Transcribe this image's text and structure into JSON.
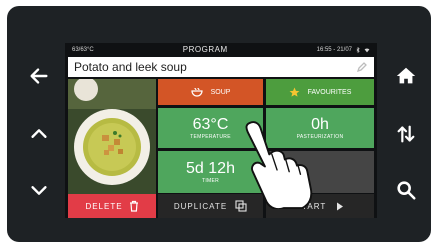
{
  "status": {
    "left": "63/63°C",
    "title": "PROGRAM",
    "right": "16:55 - 21/07"
  },
  "program": {
    "name": "Potato and leek soup"
  },
  "categories": {
    "soup": "SOUP",
    "favourites": "FAVOURITES"
  },
  "params": {
    "temperature_value": "63°C",
    "temperature_label": "TEMPERATURE",
    "duration_value": "0h",
    "duration_label": "PASTEURIZATION",
    "timer_value": "5d 12h",
    "timer_label": "TIMER"
  },
  "actions": {
    "delete": "DELETE",
    "duplicate": "DUPLICATE",
    "start": "START"
  },
  "icons": {
    "back": "arrow-left-icon",
    "up": "chevron-up-icon",
    "down": "chevron-down-icon",
    "home": "home-icon",
    "sort": "sort-arrows-icon",
    "search": "search-icon"
  },
  "colors": {
    "soup_tile": "#d35526",
    "favourites_tile": "#4d9d3e",
    "param_tile": "#4fa65d",
    "delete_button": "#e23c47"
  }
}
